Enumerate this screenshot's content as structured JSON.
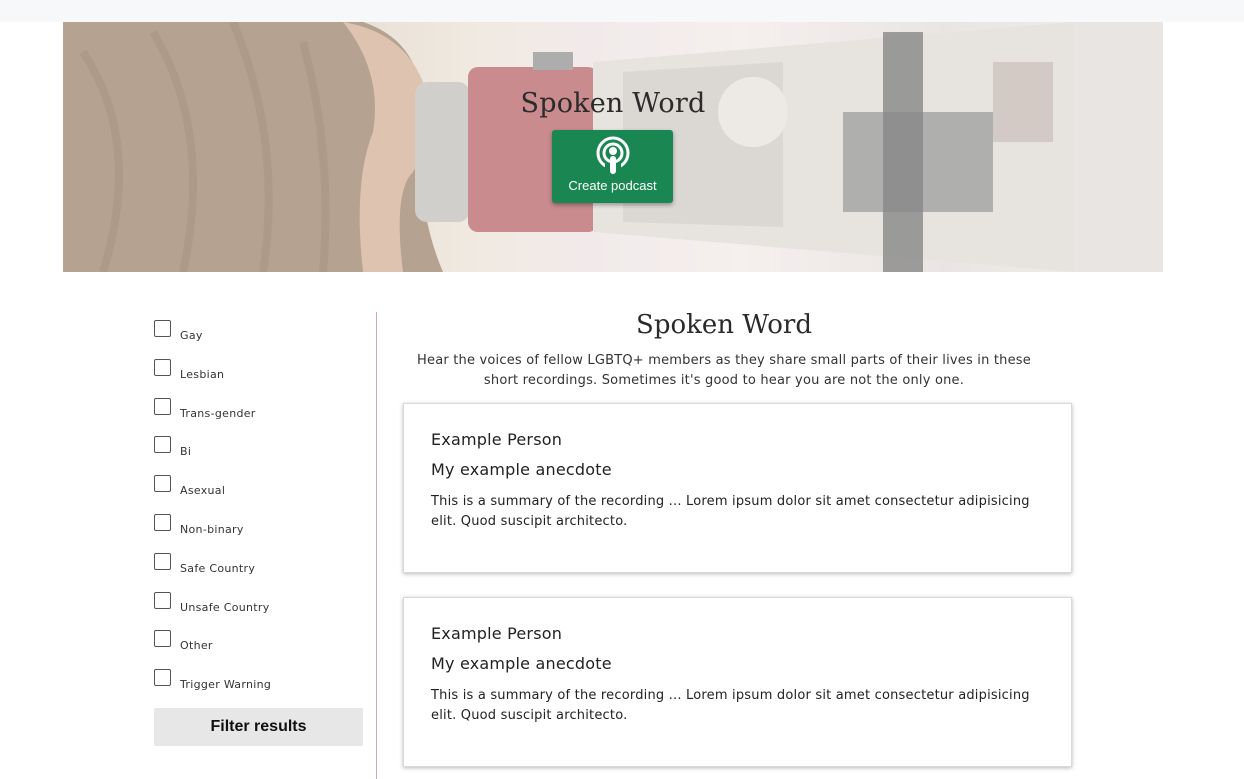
{
  "hero": {
    "title": "Spoken Word",
    "podcast_button_label": "Create podcast",
    "podcast_icon": "podcast-icon",
    "accent_color": "#1a8752"
  },
  "filters": {
    "items": [
      {
        "label": "Gay",
        "checked": false
      },
      {
        "label": "Lesbian",
        "checked": false
      },
      {
        "label": "Trans-gender",
        "checked": false
      },
      {
        "label": "Bi",
        "checked": false
      },
      {
        "label": "Asexual",
        "checked": false
      },
      {
        "label": "Non-binary",
        "checked": false
      },
      {
        "label": "Safe Country",
        "checked": false
      },
      {
        "label": "Unsafe Country",
        "checked": false
      },
      {
        "label": "Other",
        "checked": false
      },
      {
        "label": "Trigger Warning",
        "checked": false
      }
    ],
    "button_label": "Filter results"
  },
  "main": {
    "title": "Spoken Word",
    "description": "Hear the voices of fellow LGBTQ+ members as they share small parts of their lives in these short recordings. Sometimes it's good to hear you are not the only one."
  },
  "recordings": [
    {
      "person": "Example Person",
      "title": "My example anecdote",
      "summary": "This is a summary of the recording ... Lorem ipsum dolor sit amet consectetur adipisicing elit. Quod suscipit architecto."
    },
    {
      "person": "Example Person",
      "title": "My example anecdote",
      "summary": "This is a summary of the recording ... Lorem ipsum dolor sit amet consectetur adipisicing elit. Quod suscipit architecto."
    }
  ]
}
